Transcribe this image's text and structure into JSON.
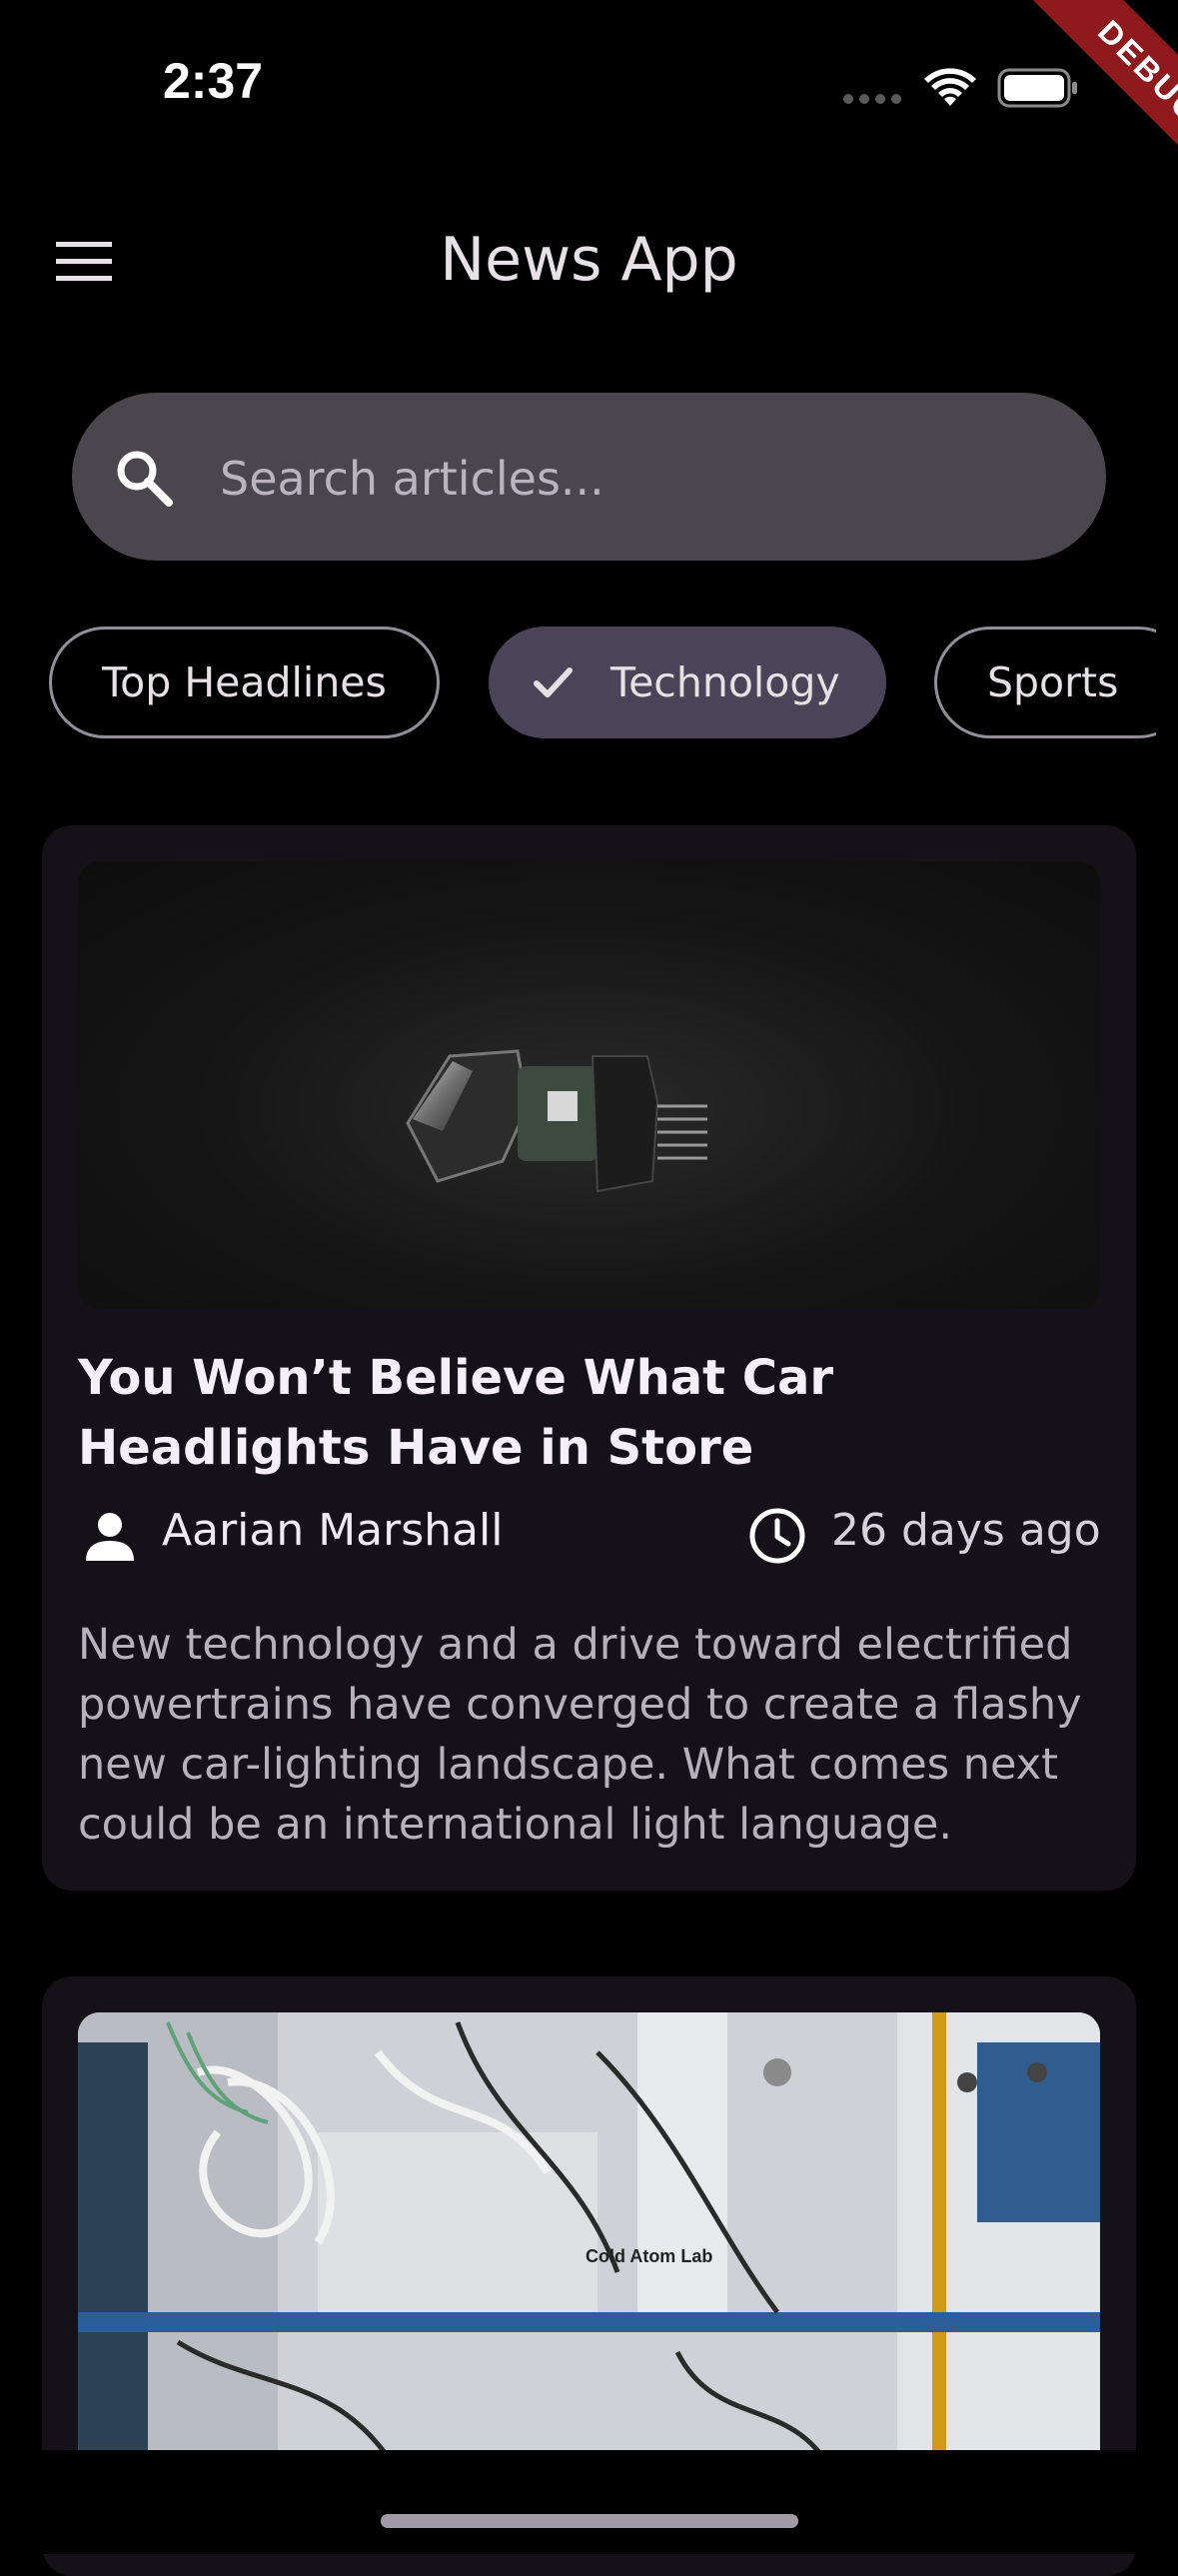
{
  "status_bar": {
    "time": "2:37"
  },
  "debug_banner": "DEBUG",
  "app_bar": {
    "title": "News App",
    "menu_icon": "menu-icon"
  },
  "search": {
    "placeholder": "Search articles...",
    "value": "",
    "icon": "search-icon"
  },
  "categories": [
    {
      "label": "Top Headlines",
      "selected": false
    },
    {
      "label": "Technology",
      "selected": true
    },
    {
      "label": "Sports",
      "selected": false
    }
  ],
  "articles": [
    {
      "title": "You Won’t Believe What Car Headlights Have in Store",
      "author": "Aarian Marshall",
      "time_ago": "26 days ago",
      "description": "New technology and a drive toward electrified powertrains have converged to create a flashy new car-lighting landscape. What comes next could be an international light language."
    },
    {
      "image_caption": "Cold Atom Lab"
    }
  ],
  "colors": {
    "background": "#000000",
    "surface": "#141218",
    "search_fill": "#49464D",
    "selected_chip": "#4A4458",
    "debug_ribbon": "#8F1A1E"
  }
}
